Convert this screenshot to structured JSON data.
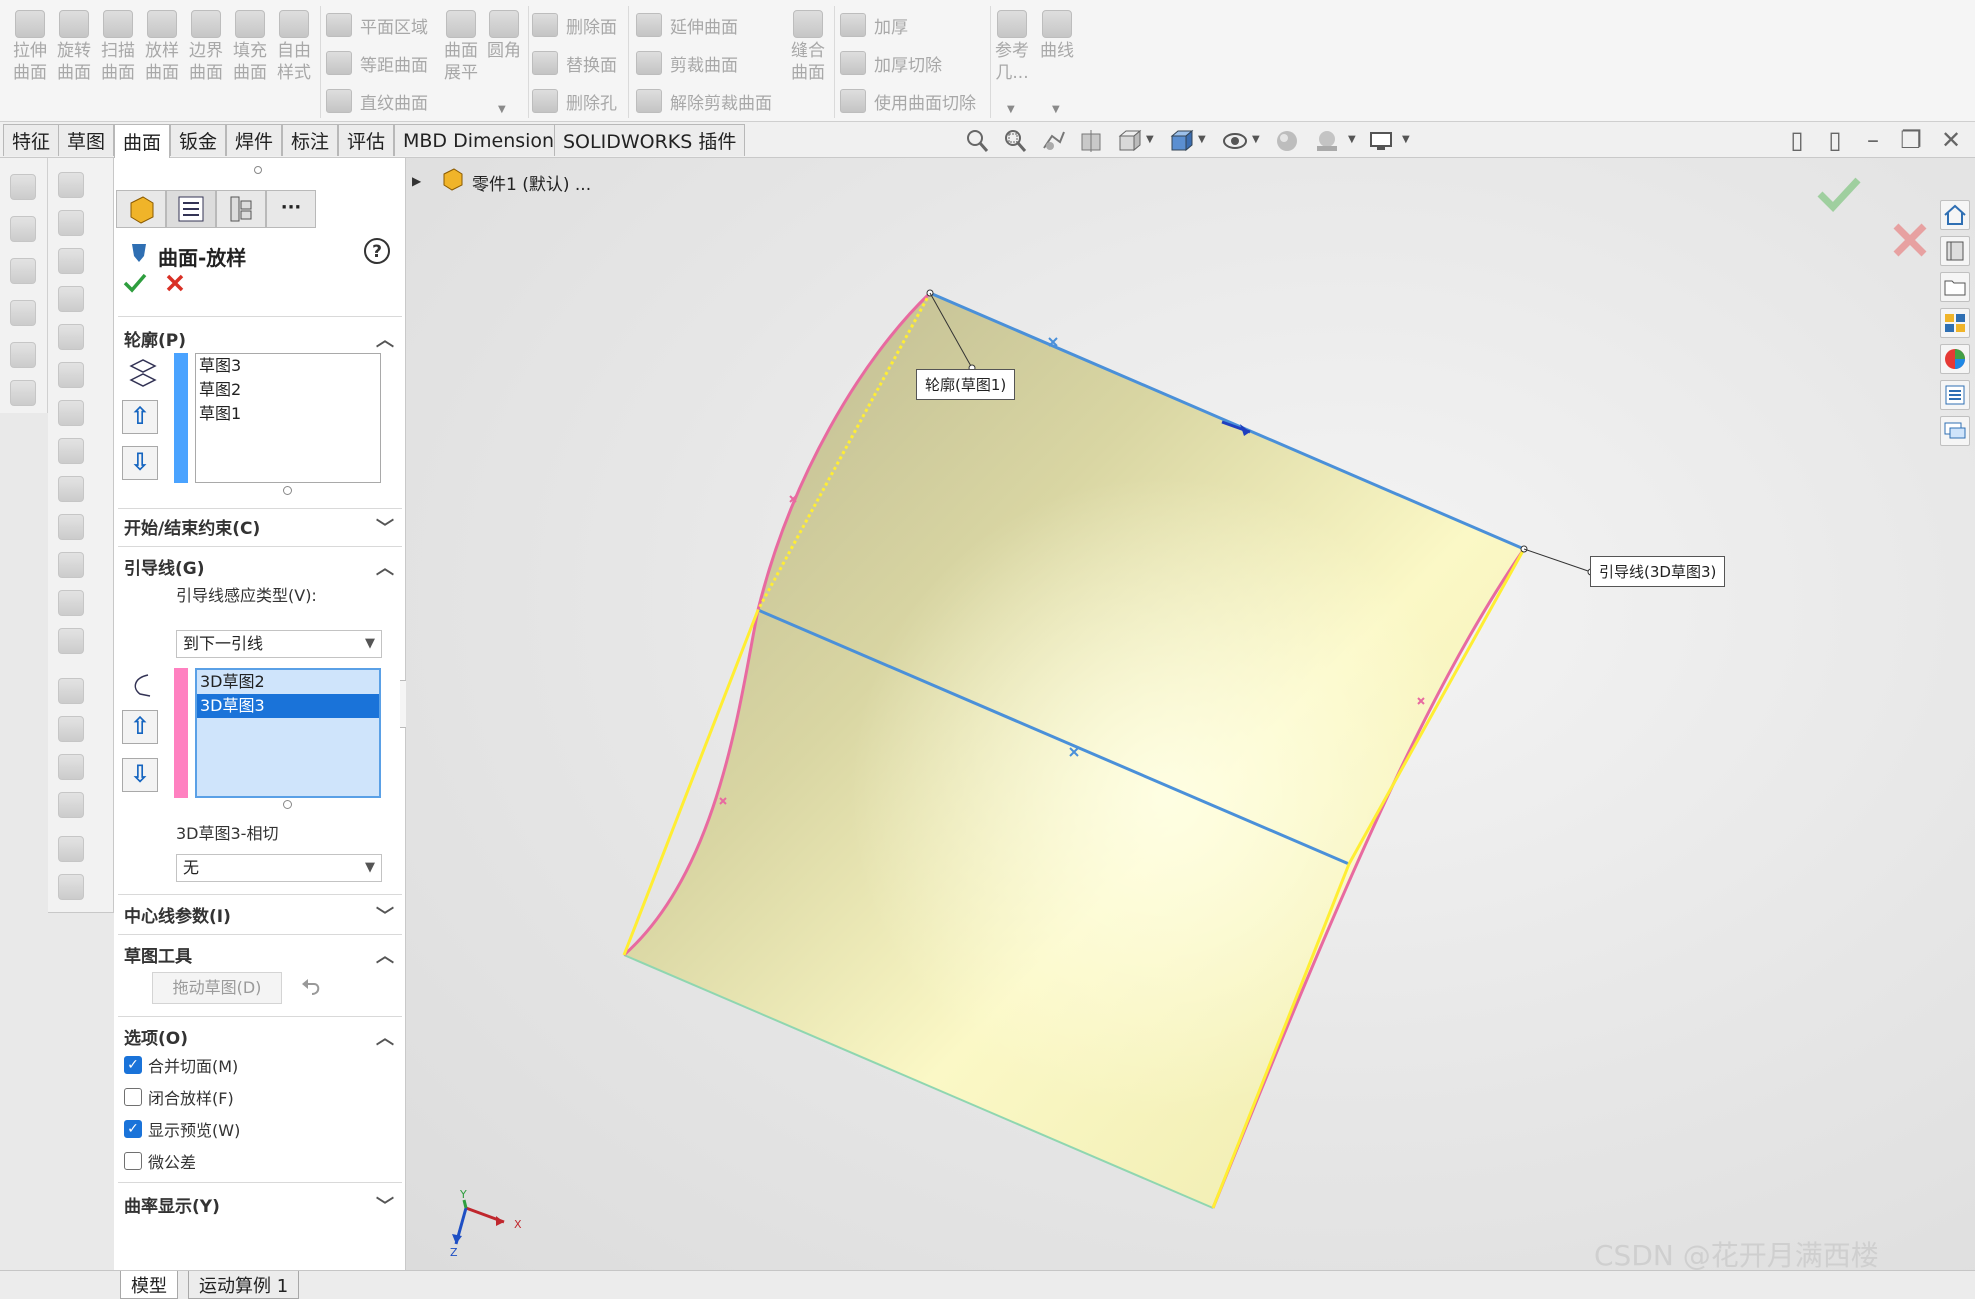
{
  "ribbon": {
    "large_buttons": [
      {
        "line1": "拉伸",
        "line2": "曲面",
        "name": "extruded-surface"
      },
      {
        "line1": "旋转",
        "line2": "曲面",
        "name": "revolved-surface"
      },
      {
        "line1": "扫描",
        "line2": "曲面",
        "name": "swept-surface"
      },
      {
        "line1": "放样",
        "line2": "曲面",
        "name": "lofted-surface"
      },
      {
        "line1": "边界",
        "line2": "曲面",
        "name": "boundary-surface"
      },
      {
        "line1": "填充",
        "line2": "曲面",
        "name": "filled-surface"
      },
      {
        "line1": "自由",
        "line2": "样式",
        "name": "freeform"
      }
    ],
    "col2": [
      "平面区域",
      "等距曲面",
      "直纹曲面"
    ],
    "flatten": {
      "line1": "曲面",
      "line2": "展平"
    },
    "fillet": "圆角",
    "col3": [
      "删除面",
      "替换面",
      "删除孔"
    ],
    "col4": [
      "延伸曲面",
      "剪裁曲面",
      "解除剪裁曲面"
    ],
    "knit": {
      "line1": "缝合",
      "line2": "曲面"
    },
    "col5": [
      "加厚",
      "加厚切除",
      "使用曲面切除"
    ],
    "ref_geom": {
      "line1": "参考",
      "line2": "几..."
    },
    "curves": "曲线"
  },
  "tabs": [
    "特征",
    "草图",
    "曲面",
    "钣金",
    "焊件",
    "标注",
    "评估",
    "MBD Dimensions",
    "SOLIDWORKS 插件"
  ],
  "active_tab": "曲面",
  "tree": {
    "part_label": "零件1 (默认) ..."
  },
  "pm": {
    "title": "曲面-放样",
    "profiles": {
      "header": "轮廓(P)",
      "items": [
        "草图3",
        "草图2",
        "草图1"
      ]
    },
    "start_end": {
      "header": "开始/结束约束(C)"
    },
    "guides": {
      "header": "引导线(G)",
      "influence_label": "引导线感应类型(V):",
      "influence_value": "到下一引线",
      "items": [
        "3D草图2",
        "3D草图3"
      ],
      "selected": "3D草图3",
      "tangency_label": "3D草图3-相切",
      "tangency_value": "无"
    },
    "centerline": {
      "header": "中心线参数(I)"
    },
    "sketch_tools": {
      "header": "草图工具",
      "drag_button": "拖动草图(D)"
    },
    "options": {
      "header": "选项(O)",
      "merge": {
        "label": "合并切面(M)",
        "checked": true
      },
      "close": {
        "label": "闭合放样(F)",
        "checked": false
      },
      "preview": {
        "label": "显示预览(W)",
        "checked": true
      },
      "micro": {
        "label": "微公差",
        "checked": false
      }
    },
    "curvature": {
      "header": "曲率显示(Y)"
    }
  },
  "callouts": {
    "profile": "轮廓(草图1)",
    "guide": "引导线(3D草图3)"
  },
  "triad": {
    "x": "X",
    "y": "Y",
    "z": "Z"
  },
  "bottom_tabs": [
    "模型",
    "运动算例 1"
  ],
  "watermark": "CSDN @花开月满西楼",
  "colors": {
    "surface": "#f2f0b8",
    "profile_blue": "#4a90d9",
    "guide_pink": "#e86aa0",
    "guide_yellow": "#ffee33",
    "accept_green": "#2e9e3e",
    "cancel_red": "#d93025"
  }
}
